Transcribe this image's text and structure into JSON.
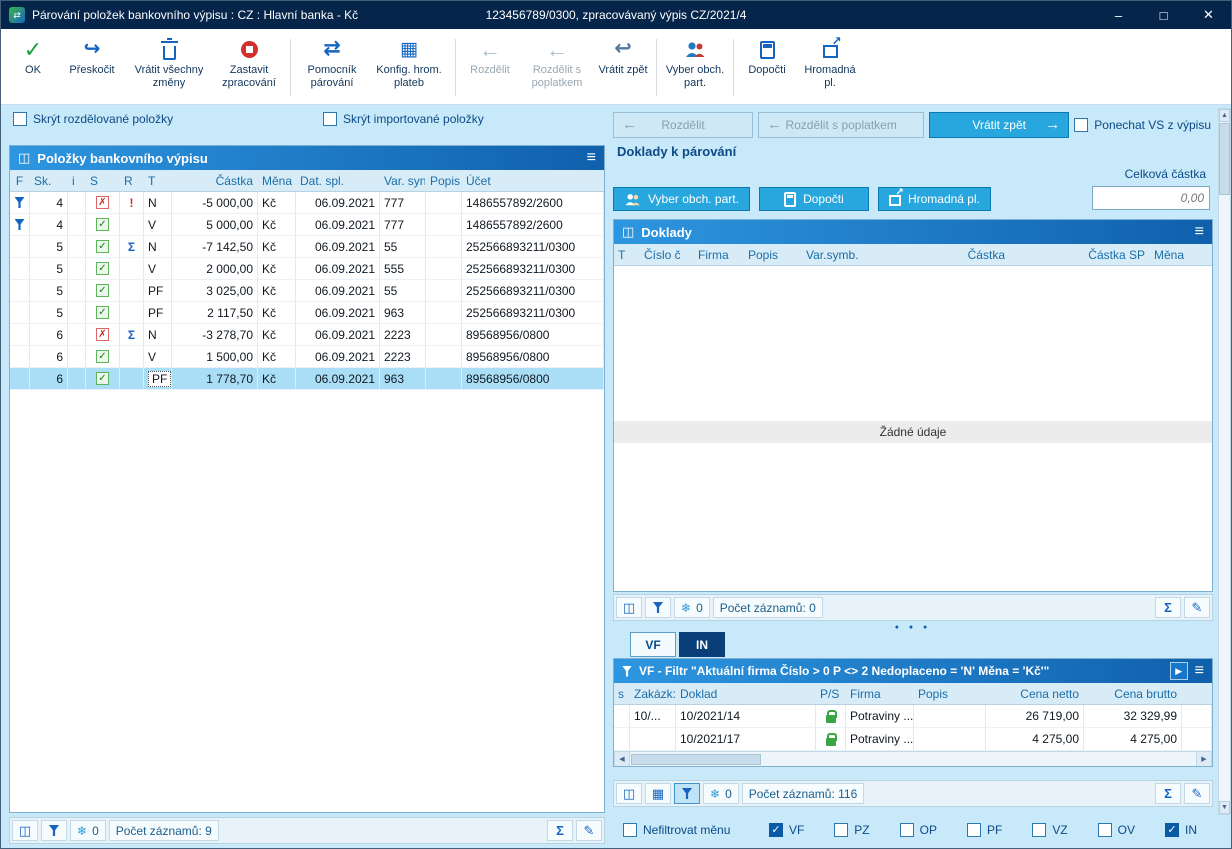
{
  "window": {
    "title": "Párování položek bankovního výpisu : CZ : Hlavní banka - Kč",
    "subtitle": "123456789/0300, zpracovávaný výpis CZ/2021/4",
    "minimize": "–",
    "maximize": "□",
    "close": "✕"
  },
  "icons": {
    "check": "✓",
    "cross": "✗",
    "skip": "↪",
    "pair": "⇄",
    "grid": "▦",
    "arrow_left": "←",
    "arrow_right": "→",
    "undo": "↩",
    "sum": "Σ",
    "snowflake": "❄",
    "pencil": "✎",
    "menu": "≡",
    "book": "◫",
    "calendar": "▦",
    "play": "▶",
    "up": "▲",
    "down": "▼",
    "left": "◀",
    "right": "▶",
    "dots": "● ● ●"
  },
  "toolbar": {
    "buttons": [
      {
        "label": "OK"
      },
      {
        "label": "Přeskočit"
      },
      {
        "label": "Vrátit všechny změny"
      },
      {
        "label": "Zastavit zpracování"
      },
      {
        "label": "Pomocník párování"
      },
      {
        "label": "Konfig. hrom. plateb"
      },
      {
        "label": "Rozdělit"
      },
      {
        "label": "Rozdělit s poplatkem"
      },
      {
        "label": "Vrátit zpět"
      },
      {
        "label": "Vyber obch. part."
      },
      {
        "label": "Dopočti"
      },
      {
        "label": "Hromadná pl."
      }
    ]
  },
  "left_panel": {
    "hide_split": "Skrýt rozdělované položky",
    "hide_imported": "Skrýt importované položky",
    "header": "Položky bankovního výpisu",
    "columns": [
      "F",
      "Sk.",
      "i",
      "S",
      "R",
      "T",
      "Částka",
      "Měna",
      "Dat. spl.",
      "Var. syn",
      "Popis",
      "Účet"
    ],
    "rows": [
      {
        "sk": "4",
        "r": "!",
        "t": "N",
        "amount": "-5 000,00",
        "currency": "Kč",
        "date": "06.09.2021",
        "varsym": "777",
        "popis": "",
        "account": "1486557892/2600"
      },
      {
        "sk": "4",
        "r": "",
        "t": "V",
        "amount": "5 000,00",
        "currency": "Kč",
        "date": "06.09.2021",
        "varsym": "777",
        "popis": "",
        "account": "1486557892/2600"
      },
      {
        "sk": "5",
        "r": "Σ",
        "t": "N",
        "amount": "-7 142,50",
        "currency": "Kč",
        "date": "06.09.2021",
        "varsym": "55",
        "popis": "",
        "account": "252566893211/0300"
      },
      {
        "sk": "5",
        "r": "",
        "t": "V",
        "amount": "2 000,00",
        "currency": "Kč",
        "date": "06.09.2021",
        "varsym": "555",
        "popis": "",
        "account": "252566893211/0300"
      },
      {
        "sk": "5",
        "r": "",
        "t": "PF",
        "amount": "3 025,00",
        "currency": "Kč",
        "date": "06.09.2021",
        "varsym": "55",
        "popis": "",
        "account": "252566893211/0300"
      },
      {
        "sk": "5",
        "r": "",
        "t": "PF",
        "amount": "2 117,50",
        "currency": "Kč",
        "date": "06.09.2021",
        "varsym": "963",
        "popis": "",
        "account": "252566893211/0300"
      },
      {
        "sk": "6",
        "r": "Σ",
        "t": "N",
        "amount": "-3 278,70",
        "currency": "Kč",
        "date": "06.09.2021",
        "varsym": "2223",
        "popis": "",
        "account": "89568956/0800"
      },
      {
        "sk": "6",
        "r": "",
        "t": "V",
        "amount": "1 500,00",
        "currency": "Kč",
        "date": "06.09.2021",
        "varsym": "2223",
        "popis": "",
        "account": "89568956/0800"
      },
      {
        "sk": "6",
        "r": "",
        "t": "PF",
        "amount": "1 778,70",
        "currency": "Kč",
        "date": "06.09.2021",
        "varsym": "963",
        "popis": "",
        "account": "89568956/0800"
      }
    ],
    "status": {
      "frozen": "0",
      "count": "Počet záznamů: 9"
    }
  },
  "right_top": {
    "split": "Rozdělit",
    "split_fee": "Rozdělit s poplatkem",
    "undo": "Vrátit zpět",
    "keep_vs": "Ponechat VS z výpisu"
  },
  "pairing": {
    "title": "Doklady k párování",
    "total_label": "Celková částka",
    "total_value": "0,00",
    "select_partner": "Vyber obch. part.",
    "recompute": "Dopočti",
    "bulk": "Hromadná pl."
  },
  "documents": {
    "header": "Doklady",
    "columns": [
      "T",
      "Číslo č",
      "Firma",
      "Popis",
      "Var.symb.",
      "Částka",
      "Částka SP",
      "Měna"
    ],
    "empty": "Žádné údaje",
    "status": {
      "frozen": "0",
      "count": "Počet záznamů: 0"
    }
  },
  "invoices": {
    "tabs": [
      "VF",
      "IN"
    ],
    "filter": "VF - Filtr \"Aktuální firma  Číslo > 0  P <> 2  Nedoplaceno = 'N'  Měna = 'Kč'\"",
    "columns": [
      "s",
      "Zakázk:",
      "Doklad",
      "P/S",
      "Firma",
      "Popis",
      "Cena netto",
      "Cena brutto"
    ],
    "rows": [
      {
        "zakazka": "10/...",
        "doklad": "10/2021/14",
        "firma": "Potraviny ...",
        "popis": "",
        "netto": "26 719,00",
        "brutto": "32 329,99"
      },
      {
        "zakazka": "",
        "doklad": "10/2021/17",
        "firma": "Potraviny ...",
        "popis": "",
        "netto": "4 275,00",
        "brutto": "4 275,00"
      }
    ],
    "status": {
      "frozen": "0",
      "count": "Počet záznamů: 116"
    }
  },
  "filters": {
    "no_currency": "Nefiltrovat měnu",
    "types": [
      {
        "label": "VF",
        "checked": true
      },
      {
        "label": "PZ",
        "checked": false
      },
      {
        "label": "OP",
        "checked": false
      },
      {
        "label": "PF",
        "checked": false
      },
      {
        "label": "VZ",
        "checked": false
      },
      {
        "label": "OV",
        "checked": false
      },
      {
        "label": "IN",
        "checked": true
      }
    ]
  },
  "colors": {
    "titlebar": "#05254a",
    "accent_blue": "#1565c0",
    "header_gradient_start": "#2e96e0",
    "header_gradient_end": "#1060ac",
    "cyan_button": "#28a7de",
    "panel_bg": "#c7e9f9",
    "selected_row": "#aadef6",
    "checked_blue": "#0a5aa6",
    "ok_green": "#2e9e2e",
    "error_red": "#d22b2b"
  }
}
